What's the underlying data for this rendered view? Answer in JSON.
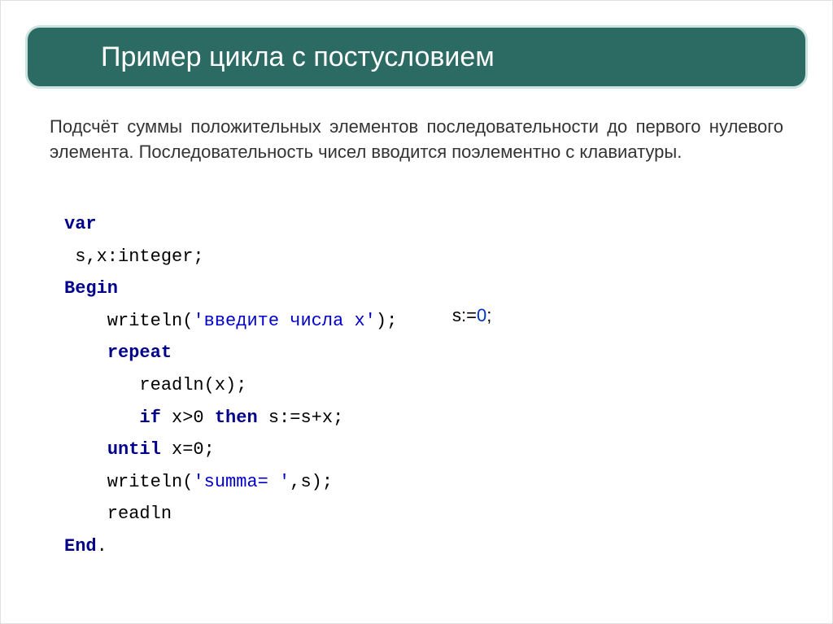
{
  "title": "Пример цикла с постусловием",
  "problem": "Подсчёт суммы положительных элементов последовательности до первого нулевого элемента. Последовательность чисел вводится поэлементно с клавиатуры.",
  "code": {
    "l1_kw": "var",
    "l2": " s,x:integer;",
    "l3_kw": "Begin",
    "l4a": "    writeln(",
    "l4_str": "'введите числа x'",
    "l4b": ");",
    "l5_ind": "    ",
    "l5_kw": "repeat",
    "l6": "       readln(x);",
    "l7a": "       ",
    "l7_kw1": "if",
    "l7b": " x>0 ",
    "l7_kw2": "then",
    "l7c": " s:=s+x;",
    "l8_ind": "    ",
    "l8_kw": "until",
    "l8b": " x=0;",
    "l9a": "    writeln(",
    "l9_str": "'summa= '",
    "l9b": ",s);",
    "l10": "    readln",
    "l11_kw": "End",
    "l11b": "."
  },
  "annotation": {
    "a": "s:=",
    "zero": "0",
    "b": ";"
  }
}
